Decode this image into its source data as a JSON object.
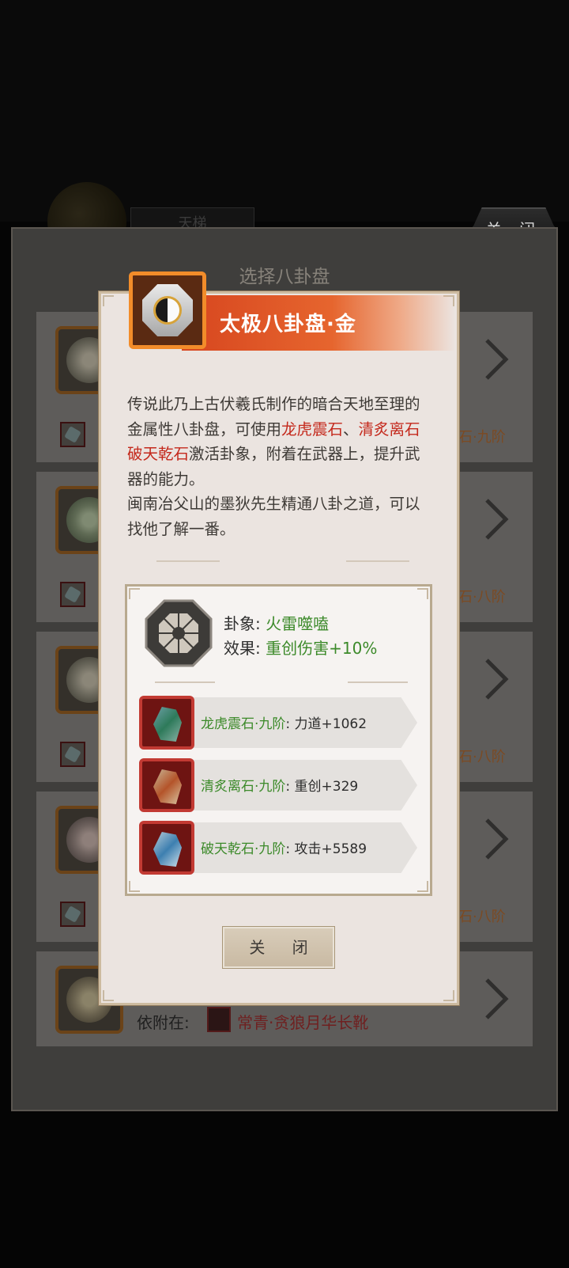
{
  "top_close_label": "关 闭",
  "background": {
    "tab_label": "天梯"
  },
  "panel": {
    "title": "选择八卦盘",
    "items": [
      {
        "stone_label": "石·九阶"
      },
      {
        "stone_label": "石·八阶"
      },
      {
        "stone_label": "石·八阶"
      },
      {
        "stone_label": "石·八阶"
      },
      {
        "attach_label": "依附在:",
        "attach_item": "常青·贪狼月华长靴"
      }
    ]
  },
  "modal": {
    "title": "太极八卦盘·金",
    "desc": {
      "p1": "传说此乃上古伏羲氏制作的暗合天地至理的金属性八卦盘，可使用",
      "stone1": "龙虎震石",
      "sep1": "、",
      "stone2": "清炙离石",
      "sep2": "、",
      "stone3": "破天乾石",
      "p2": "激活卦象，附着在武器上，提升武器的能力。",
      "p3": "闽南冶父山的墨狄先生精通八卦之道，可以找他了解一番。"
    },
    "info": {
      "gua_label": "卦象:",
      "gua_value": "火雷噬嗑",
      "effect_label": "效果:",
      "effect_value": "重创伤害+10%"
    },
    "stones": [
      {
        "name": "龙虎震石·九阶",
        "sep": ":",
        "stat": "力道+1062"
      },
      {
        "name": "清炙离石·九阶",
        "sep": ":",
        "stat": "重创+329"
      },
      {
        "name": "破天乾石·九阶",
        "sep": ":",
        "stat": "攻击+5589"
      }
    ],
    "close_label": "关 闭"
  },
  "colors": {
    "accent_orange": "#e6652e",
    "value_green": "#3c8a2a",
    "highlight_red": "#c4291c"
  }
}
